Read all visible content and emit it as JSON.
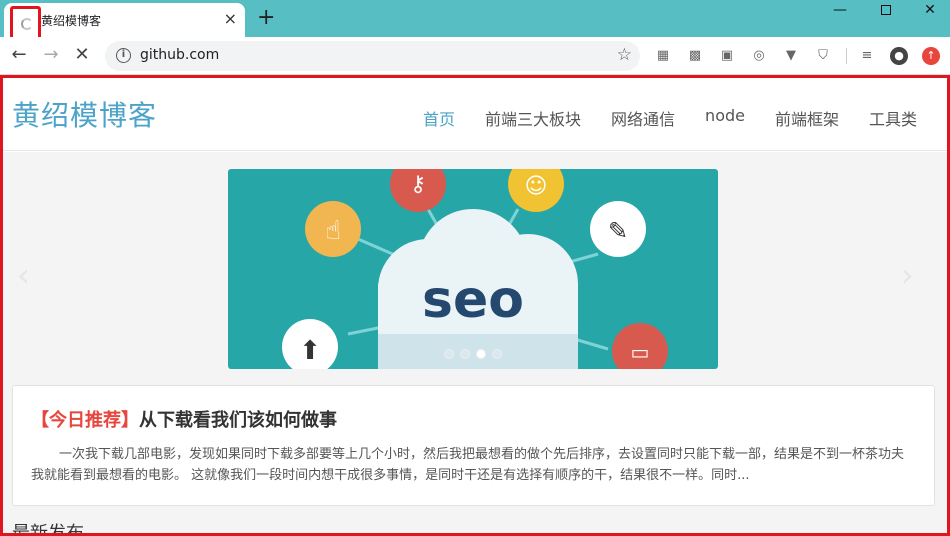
{
  "browser": {
    "tab": {
      "title": "黄绍模博客",
      "close": "×"
    },
    "new_tab": "+",
    "window": {
      "minimize": "—",
      "close": "✕"
    },
    "toolbar": {
      "back": "←",
      "forward": "→",
      "reload": "✕",
      "url": "github.com",
      "star": "☆"
    }
  },
  "site": {
    "logo": "黄绍模博客",
    "nav": [
      {
        "label": "首页",
        "active": true
      },
      {
        "label": "前端三大板块"
      },
      {
        "label": "网络通信"
      },
      {
        "label": "node"
      },
      {
        "label": "前端框架"
      },
      {
        "label": "工具类"
      }
    ],
    "carousel": {
      "text": "seo",
      "prev": "‹",
      "next": "›",
      "dots": 4,
      "active_dot": 2
    },
    "featured": {
      "tag": "【今日推荐】",
      "title": "从下载看我们该如何做事",
      "excerpt": "一次我下载几部电影，发现如果同时下载多部要等上几个小时，然后我把最想看的做个先后排序，去设置同时只能下载一部，结果是不到一杯茶功夫我就能看到最想看的电影。 这就像我们一段时间内想干成很多事情，是同时干还是有选择有顺序的干，结果很不一样。同时..."
    },
    "section_title": "最新发布"
  },
  "colors": {
    "tabbar": "#57bfc4",
    "accent": "#4ba3c7",
    "highlight": "#e0161e",
    "carousel_bg": "#27a6a8"
  }
}
